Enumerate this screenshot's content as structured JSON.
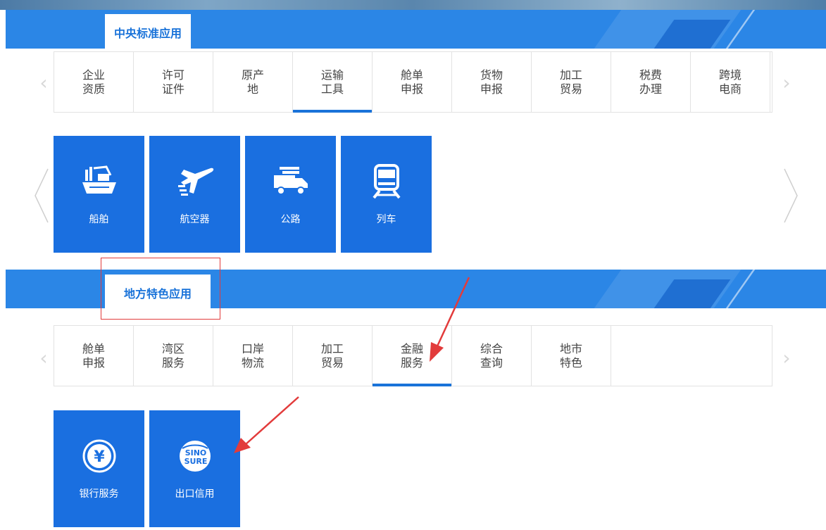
{
  "central": {
    "section_title": "中央标准应用",
    "tabs": [
      {
        "label": "企业\n资质",
        "active": false
      },
      {
        "label": "许可\n证件",
        "active": false
      },
      {
        "label": "原产\n地",
        "active": false
      },
      {
        "label": "运输\n工具",
        "active": true
      },
      {
        "label": "舱单\n申报",
        "active": false
      },
      {
        "label": "货物\n申报",
        "active": false
      },
      {
        "label": "加工\n贸易",
        "active": false
      },
      {
        "label": "税费\n办理",
        "active": false
      },
      {
        "label": "跨境\n电商",
        "active": false
      }
    ],
    "tiles": [
      {
        "label": "船舶",
        "icon": "ship-icon"
      },
      {
        "label": "航空器",
        "icon": "airplane-icon"
      },
      {
        "label": "公路",
        "icon": "truck-icon"
      },
      {
        "label": "列车",
        "icon": "train-icon"
      }
    ]
  },
  "local": {
    "section_title": "地方特色应用",
    "tabs": [
      {
        "label": "舱单\n申报",
        "active": false
      },
      {
        "label": "湾区\n服务",
        "active": false
      },
      {
        "label": "口岸\n物流",
        "active": false
      },
      {
        "label": "加工\n贸易",
        "active": false
      },
      {
        "label": "金融\n服务",
        "active": true
      },
      {
        "label": "综合\n查询",
        "active": false
      },
      {
        "label": "地市\n特色",
        "active": false
      }
    ],
    "tiles": [
      {
        "label": "银行服务",
        "icon": "yuan-coin-icon"
      },
      {
        "label": "出口信用",
        "icon": "sinosure-logo-icon",
        "logo_text": [
          "SINO",
          "SURE"
        ]
      }
    ]
  },
  "colors": {
    "accent": "#1a73d9",
    "band": "#2b86e6",
    "tile": "#1a6fe0",
    "annotation": "#e23b3b"
  }
}
